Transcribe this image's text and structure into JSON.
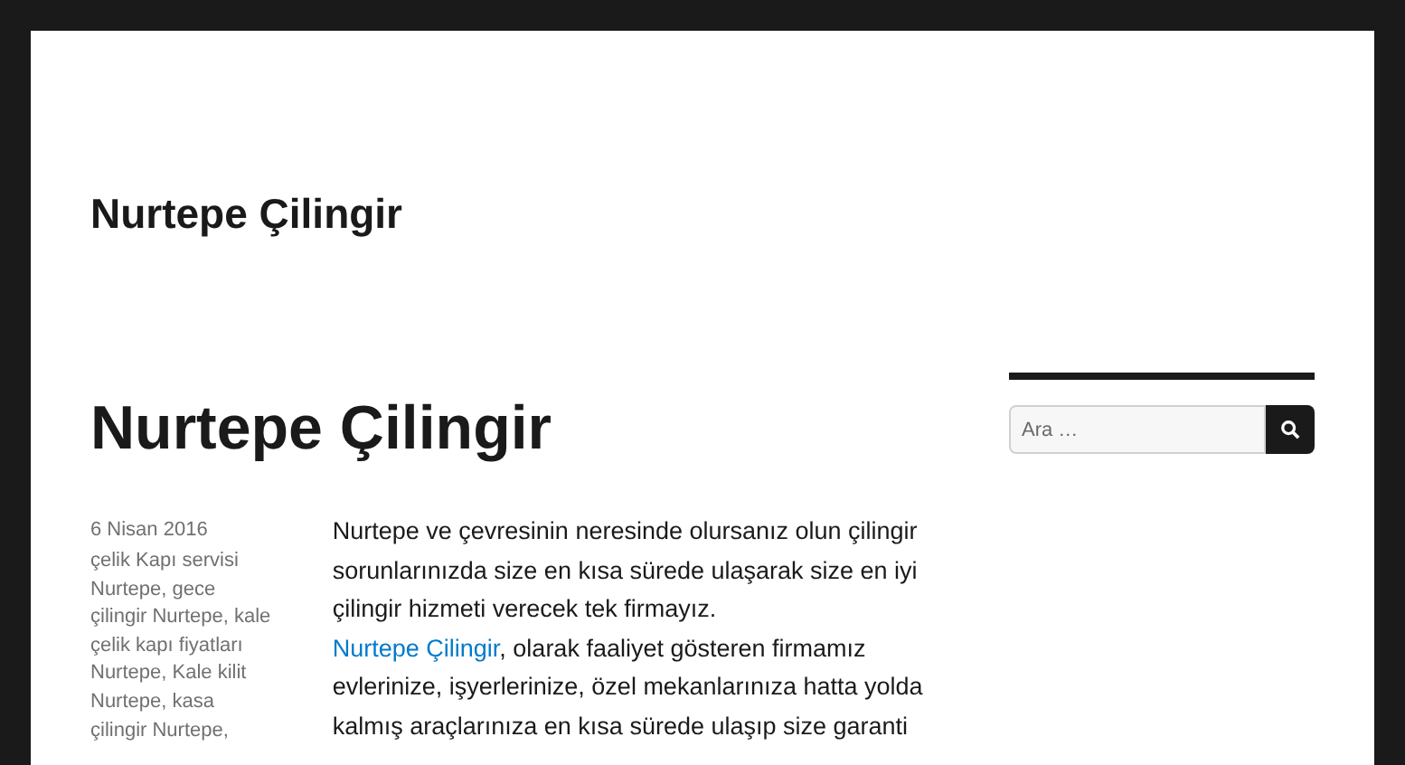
{
  "site_title": "Nurtepe Çilingir",
  "post": {
    "title": "Nurtepe Çilingir",
    "date": "6 Nisan 2016",
    "tags": "çelik Kapı servisi Nurtepe, gece çilingir Nurtepe, kale çelik kapı fiyatları Nurtepe, Kale kilit Nurtepe, kasa çilingir Nurtepe,",
    "paragraphs": [
      {
        "text": "Nurtepe ve çevresinin neresinde olursanız olun çilingir sorunlarınızda size en kısa sürede ulaşarak size en iyi çilingir hizmeti verecek tek firmayız."
      },
      {
        "link": "Nurtepe Çilingir",
        "text": ", olarak faaliyet gösteren firmamız evlerinize, işyerlerinize, özel mekanlarınıza hatta yolda kalmış araçlarınıza en kısa sürede ulaşıp size garanti"
      }
    ]
  },
  "search": {
    "placeholder": "Ara …"
  }
}
